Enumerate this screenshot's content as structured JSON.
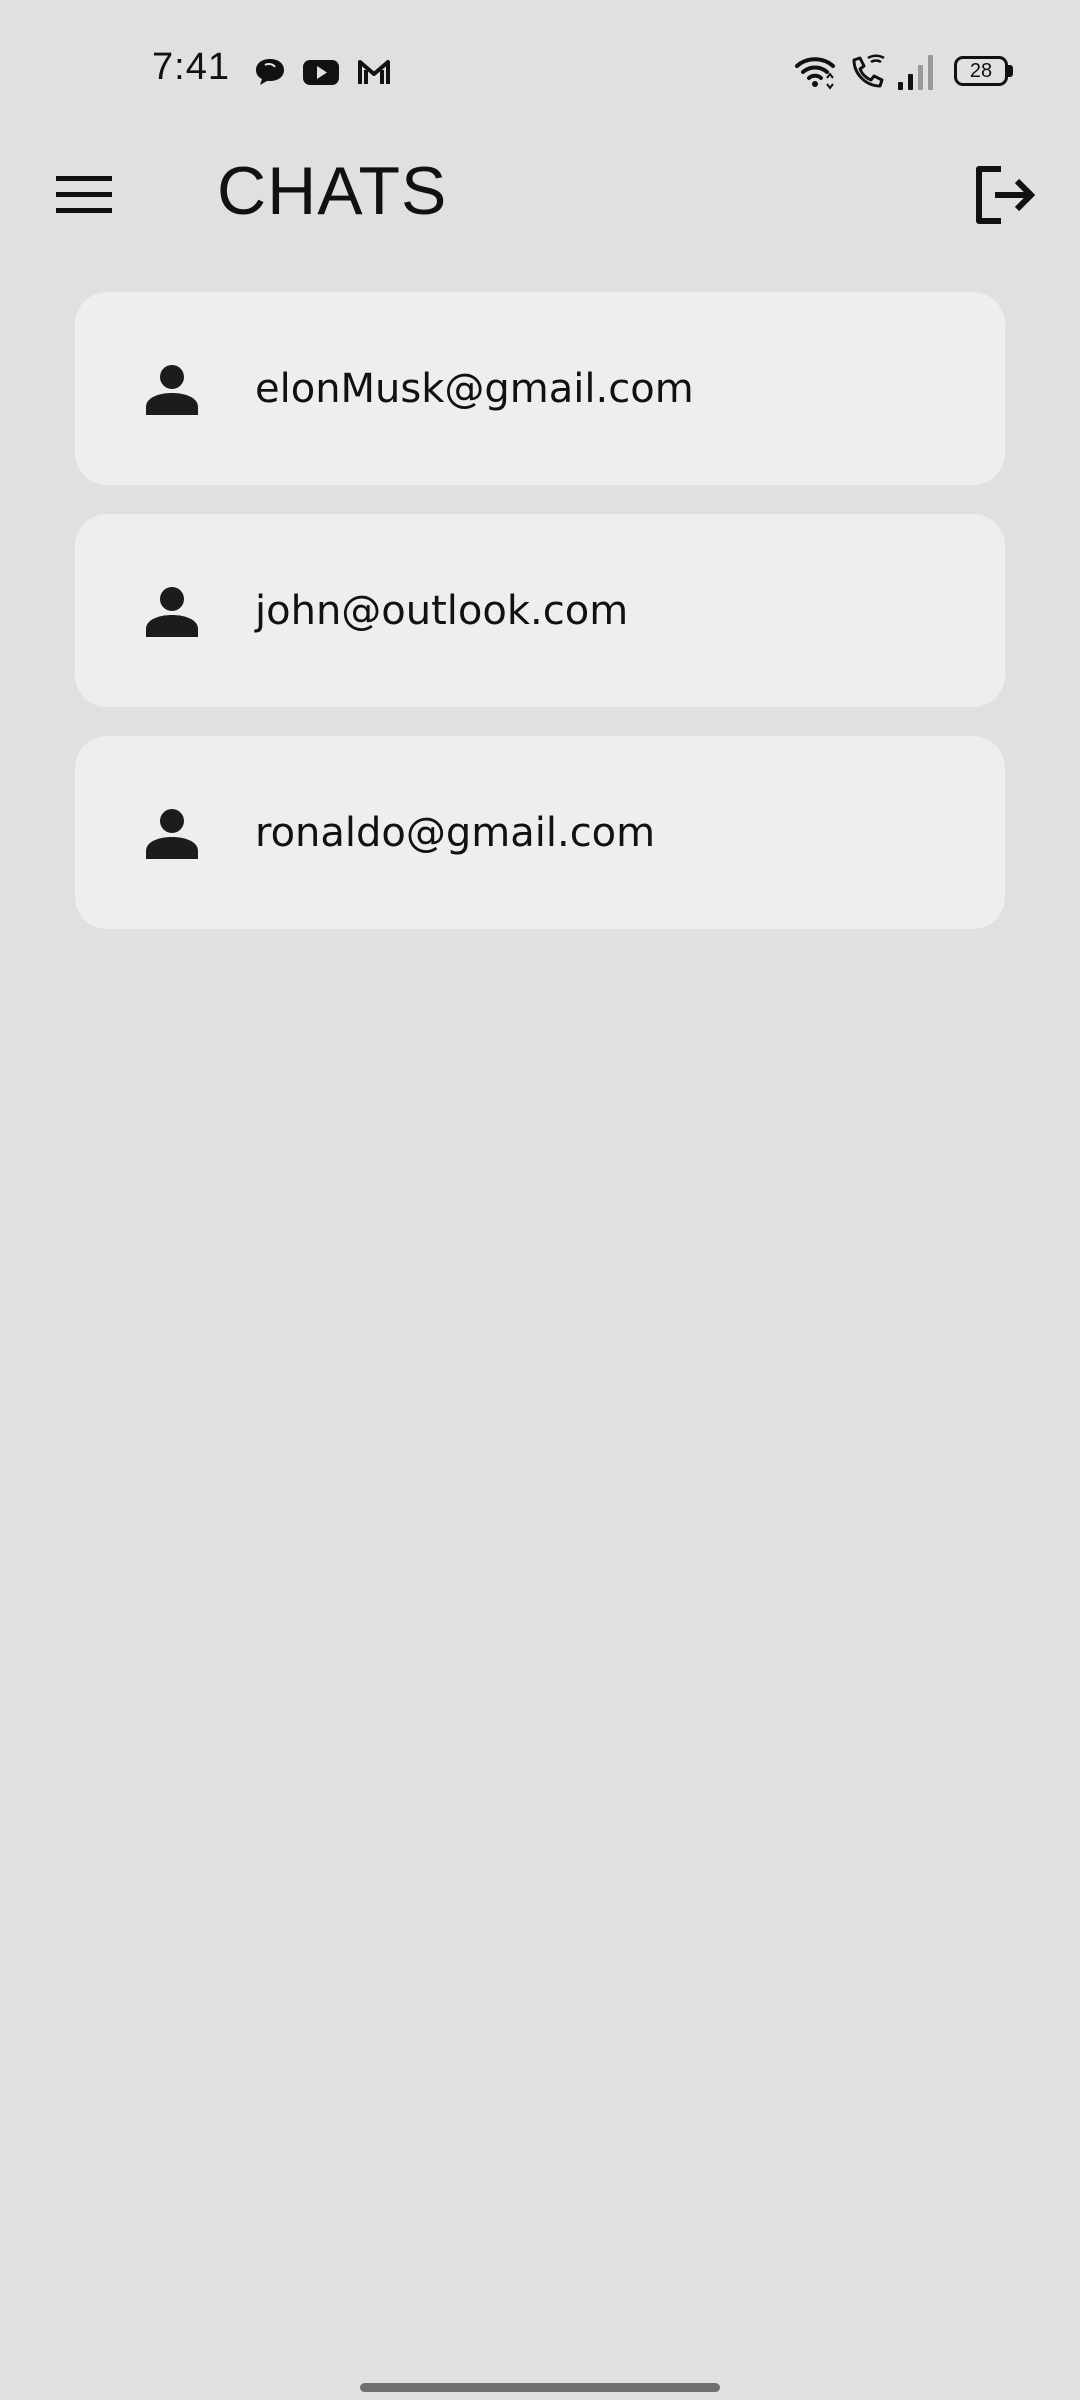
{
  "status_bar": {
    "time": "7:41",
    "notification_icons": [
      "chat-bubble-icon",
      "youtube-icon",
      "gmail-icon"
    ],
    "system_icons": [
      "wifi-icon",
      "wifi-calling-icon",
      "cellular-signal-icon"
    ],
    "battery_level": "28"
  },
  "app_bar": {
    "title": "CHATS",
    "menu_icon": "hamburger-menu-icon",
    "logout_icon": "logout-icon"
  },
  "chats": [
    {
      "email": "elonMusk@gmail.com",
      "icon": "person-icon"
    },
    {
      "email": "john@outlook.com",
      "icon": "person-icon"
    },
    {
      "email": "ronaldo@gmail.com",
      "icon": "person-icon"
    }
  ],
  "colors": {
    "background": "#e0e0e0",
    "card": "#eeeeee",
    "icon": "#1c1c1c",
    "text": "#111111"
  }
}
